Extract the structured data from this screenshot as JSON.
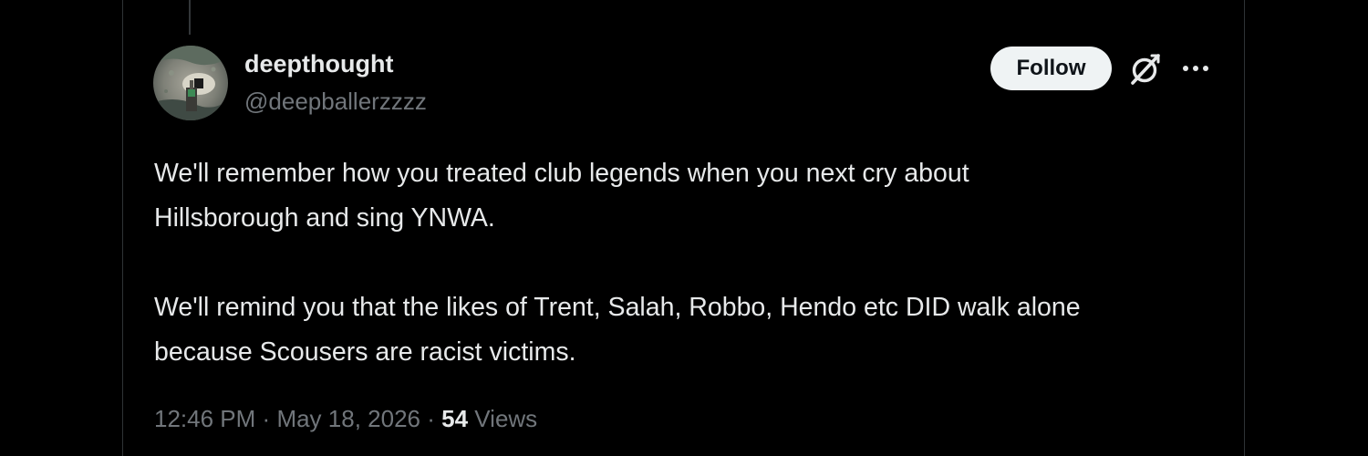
{
  "author": {
    "display_name": "deepthought",
    "handle": "@deepballerzzzz"
  },
  "actions": {
    "follow_label": "Follow",
    "grok_icon": "grok-icon",
    "more_icon": "more-icon"
  },
  "tweet": {
    "lines": [
      "We'll remember how you treated club legends when you next cry about",
      "Hillsborough and sing YNWA.",
      "",
      "We'll remind you that the likes of Trent, Salah, Robbo, Hendo etc DID walk alone",
      "because Scousers are racist victims."
    ]
  },
  "meta": {
    "time": "12:46 PM",
    "separator": "·",
    "date": "May 18, 2026",
    "views_count": "54",
    "views_label": "Views"
  },
  "colors": {
    "background": "#000000",
    "text_primary": "#e7e9ea",
    "text_secondary": "#71767b",
    "follow_bg": "#eff3f4",
    "border": "#2f3336"
  }
}
